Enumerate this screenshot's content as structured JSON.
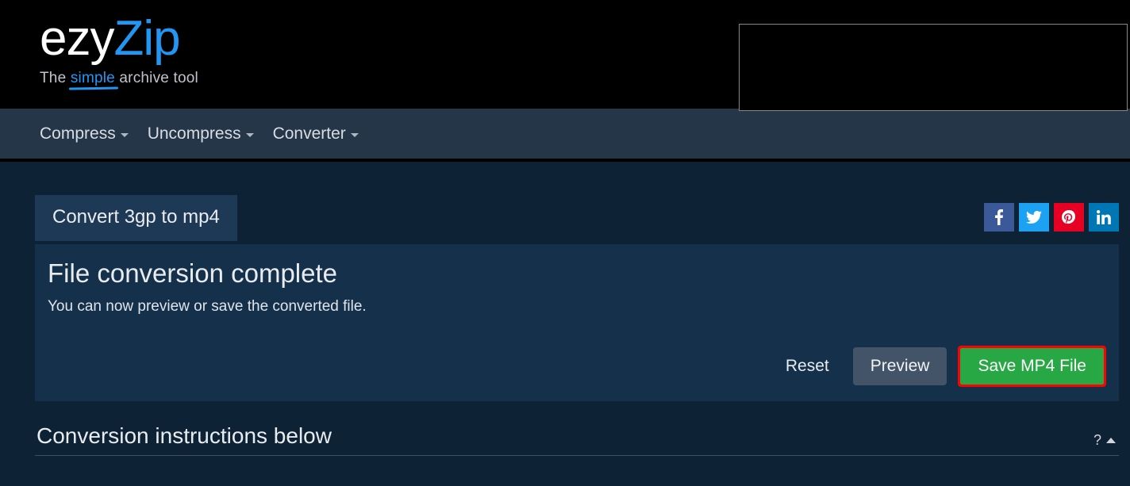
{
  "logo": {
    "part1": "ezy",
    "part2": "Zip"
  },
  "tagline": {
    "prefix": "The ",
    "simple": "simple",
    "suffix": " archive tool"
  },
  "nav": {
    "compress": "Compress",
    "uncompress": "Uncompress",
    "converter": "Converter"
  },
  "tab": {
    "label": "Convert 3gp to mp4"
  },
  "panel": {
    "heading": "File conversion complete",
    "sub": "You can now preview or save the converted file."
  },
  "buttons": {
    "reset": "Reset",
    "preview": "Preview",
    "save": "Save MP4 File"
  },
  "instructions": {
    "title": "Conversion instructions below"
  },
  "help": {
    "q": "?"
  },
  "share": {
    "facebook": "facebook",
    "twitter": "twitter",
    "pinterest": "pinterest",
    "linkedin": "linkedin"
  }
}
